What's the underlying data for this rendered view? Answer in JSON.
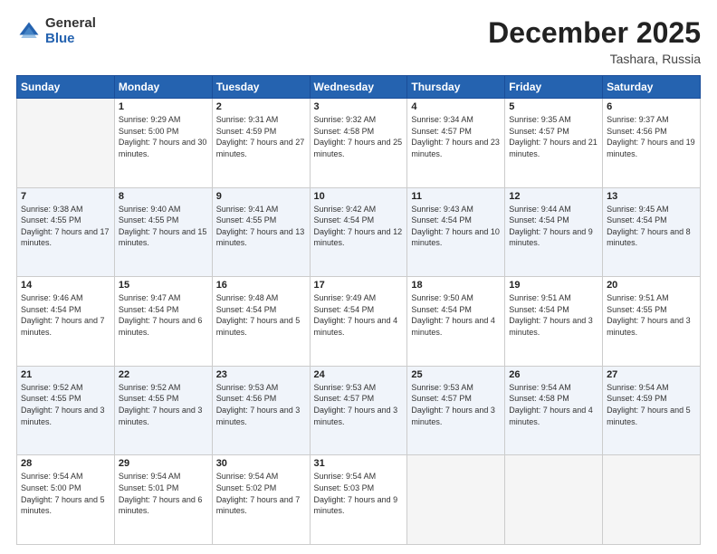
{
  "logo": {
    "general": "General",
    "blue": "Blue"
  },
  "title": "December 2025",
  "subtitle": "Tashara, Russia",
  "weekdays": [
    "Sunday",
    "Monday",
    "Tuesday",
    "Wednesday",
    "Thursday",
    "Friday",
    "Saturday"
  ],
  "weeks": [
    [
      {
        "day": "",
        "sunrise": "",
        "sunset": "",
        "daylight": ""
      },
      {
        "day": "1",
        "sunrise": "Sunrise: 9:29 AM",
        "sunset": "Sunset: 5:00 PM",
        "daylight": "Daylight: 7 hours and 30 minutes."
      },
      {
        "day": "2",
        "sunrise": "Sunrise: 9:31 AM",
        "sunset": "Sunset: 4:59 PM",
        "daylight": "Daylight: 7 hours and 27 minutes."
      },
      {
        "day": "3",
        "sunrise": "Sunrise: 9:32 AM",
        "sunset": "Sunset: 4:58 PM",
        "daylight": "Daylight: 7 hours and 25 minutes."
      },
      {
        "day": "4",
        "sunrise": "Sunrise: 9:34 AM",
        "sunset": "Sunset: 4:57 PM",
        "daylight": "Daylight: 7 hours and 23 minutes."
      },
      {
        "day": "5",
        "sunrise": "Sunrise: 9:35 AM",
        "sunset": "Sunset: 4:57 PM",
        "daylight": "Daylight: 7 hours and 21 minutes."
      },
      {
        "day": "6",
        "sunrise": "Sunrise: 9:37 AM",
        "sunset": "Sunset: 4:56 PM",
        "daylight": "Daylight: 7 hours and 19 minutes."
      }
    ],
    [
      {
        "day": "7",
        "sunrise": "Sunrise: 9:38 AM",
        "sunset": "Sunset: 4:55 PM",
        "daylight": "Daylight: 7 hours and 17 minutes."
      },
      {
        "day": "8",
        "sunrise": "Sunrise: 9:40 AM",
        "sunset": "Sunset: 4:55 PM",
        "daylight": "Daylight: 7 hours and 15 minutes."
      },
      {
        "day": "9",
        "sunrise": "Sunrise: 9:41 AM",
        "sunset": "Sunset: 4:55 PM",
        "daylight": "Daylight: 7 hours and 13 minutes."
      },
      {
        "day": "10",
        "sunrise": "Sunrise: 9:42 AM",
        "sunset": "Sunset: 4:54 PM",
        "daylight": "Daylight: 7 hours and 12 minutes."
      },
      {
        "day": "11",
        "sunrise": "Sunrise: 9:43 AM",
        "sunset": "Sunset: 4:54 PM",
        "daylight": "Daylight: 7 hours and 10 minutes."
      },
      {
        "day": "12",
        "sunrise": "Sunrise: 9:44 AM",
        "sunset": "Sunset: 4:54 PM",
        "daylight": "Daylight: 7 hours and 9 minutes."
      },
      {
        "day": "13",
        "sunrise": "Sunrise: 9:45 AM",
        "sunset": "Sunset: 4:54 PM",
        "daylight": "Daylight: 7 hours and 8 minutes."
      }
    ],
    [
      {
        "day": "14",
        "sunrise": "Sunrise: 9:46 AM",
        "sunset": "Sunset: 4:54 PM",
        "daylight": "Daylight: 7 hours and 7 minutes."
      },
      {
        "day": "15",
        "sunrise": "Sunrise: 9:47 AM",
        "sunset": "Sunset: 4:54 PM",
        "daylight": "Daylight: 7 hours and 6 minutes."
      },
      {
        "day": "16",
        "sunrise": "Sunrise: 9:48 AM",
        "sunset": "Sunset: 4:54 PM",
        "daylight": "Daylight: 7 hours and 5 minutes."
      },
      {
        "day": "17",
        "sunrise": "Sunrise: 9:49 AM",
        "sunset": "Sunset: 4:54 PM",
        "daylight": "Daylight: 7 hours and 4 minutes."
      },
      {
        "day": "18",
        "sunrise": "Sunrise: 9:50 AM",
        "sunset": "Sunset: 4:54 PM",
        "daylight": "Daylight: 7 hours and 4 minutes."
      },
      {
        "day": "19",
        "sunrise": "Sunrise: 9:51 AM",
        "sunset": "Sunset: 4:54 PM",
        "daylight": "Daylight: 7 hours and 3 minutes."
      },
      {
        "day": "20",
        "sunrise": "Sunrise: 9:51 AM",
        "sunset": "Sunset: 4:55 PM",
        "daylight": "Daylight: 7 hours and 3 minutes."
      }
    ],
    [
      {
        "day": "21",
        "sunrise": "Sunrise: 9:52 AM",
        "sunset": "Sunset: 4:55 PM",
        "daylight": "Daylight: 7 hours and 3 minutes."
      },
      {
        "day": "22",
        "sunrise": "Sunrise: 9:52 AM",
        "sunset": "Sunset: 4:55 PM",
        "daylight": "Daylight: 7 hours and 3 minutes."
      },
      {
        "day": "23",
        "sunrise": "Sunrise: 9:53 AM",
        "sunset": "Sunset: 4:56 PM",
        "daylight": "Daylight: 7 hours and 3 minutes."
      },
      {
        "day": "24",
        "sunrise": "Sunrise: 9:53 AM",
        "sunset": "Sunset: 4:57 PM",
        "daylight": "Daylight: 7 hours and 3 minutes."
      },
      {
        "day": "25",
        "sunrise": "Sunrise: 9:53 AM",
        "sunset": "Sunset: 4:57 PM",
        "daylight": "Daylight: 7 hours and 3 minutes."
      },
      {
        "day": "26",
        "sunrise": "Sunrise: 9:54 AM",
        "sunset": "Sunset: 4:58 PM",
        "daylight": "Daylight: 7 hours and 4 minutes."
      },
      {
        "day": "27",
        "sunrise": "Sunrise: 9:54 AM",
        "sunset": "Sunset: 4:59 PM",
        "daylight": "Daylight: 7 hours and 5 minutes."
      }
    ],
    [
      {
        "day": "28",
        "sunrise": "Sunrise: 9:54 AM",
        "sunset": "Sunset: 5:00 PM",
        "daylight": "Daylight: 7 hours and 5 minutes."
      },
      {
        "day": "29",
        "sunrise": "Sunrise: 9:54 AM",
        "sunset": "Sunset: 5:01 PM",
        "daylight": "Daylight: 7 hours and 6 minutes."
      },
      {
        "day": "30",
        "sunrise": "Sunrise: 9:54 AM",
        "sunset": "Sunset: 5:02 PM",
        "daylight": "Daylight: 7 hours and 7 minutes."
      },
      {
        "day": "31",
        "sunrise": "Sunrise: 9:54 AM",
        "sunset": "Sunset: 5:03 PM",
        "daylight": "Daylight: 7 hours and 9 minutes."
      },
      {
        "day": "",
        "sunrise": "",
        "sunset": "",
        "daylight": ""
      },
      {
        "day": "",
        "sunrise": "",
        "sunset": "",
        "daylight": ""
      },
      {
        "day": "",
        "sunrise": "",
        "sunset": "",
        "daylight": ""
      }
    ]
  ]
}
